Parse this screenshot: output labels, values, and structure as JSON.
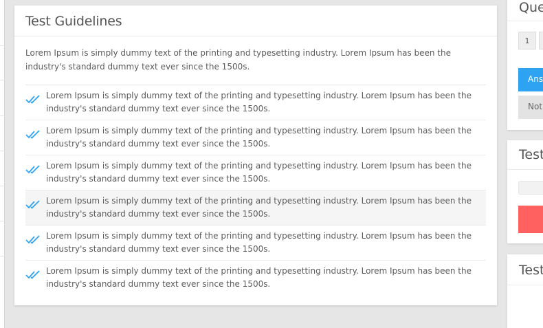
{
  "guidelines": {
    "title": "Test Guidelines",
    "intro": "Lorem Ipsum is simply dummy text of the printing and typesetting industry. Lorem Ipsum has been the industry's standard dummy text ever since the 1500s.",
    "items": [
      "Lorem Ipsum is simply dummy text of the printing and typesetting industry. Lorem Ipsum has been the industry's standard dummy text ever since the 1500s.",
      "Lorem Ipsum is simply dummy text of the printing and typesetting industry. Lorem Ipsum has been the industry's standard dummy text ever since the 1500s.",
      "Lorem Ipsum is simply dummy text of the printing and typesetting industry. Lorem Ipsum has been the industry's standard dummy text ever since the 1500s.",
      "Lorem Ipsum is simply dummy text of the printing and typesetting industry. Lorem Ipsum has been the industry's standard dummy text ever since the 1500s.",
      "Lorem Ipsum is simply dummy text of the printing and typesetting industry. Lorem Ipsum has been the industry's standard dummy text ever since the 1500s.",
      "Lorem Ipsum is simply dummy text of the printing and typesetting industry. Lorem Ipsum has been the industry's standard dummy text ever since the 1500s."
    ],
    "check_icon": "double-check-icon",
    "check_color": "#2ea3f2"
  },
  "right_panels": {
    "questions_title": "Que",
    "question_number": "1",
    "answered_label": "Ans",
    "not_answered_label": "Not",
    "test_title_1": "Test",
    "test_title_2": "Test"
  },
  "colors": {
    "accent_blue": "#2ea3f2",
    "alert_red": "#ff6161"
  }
}
